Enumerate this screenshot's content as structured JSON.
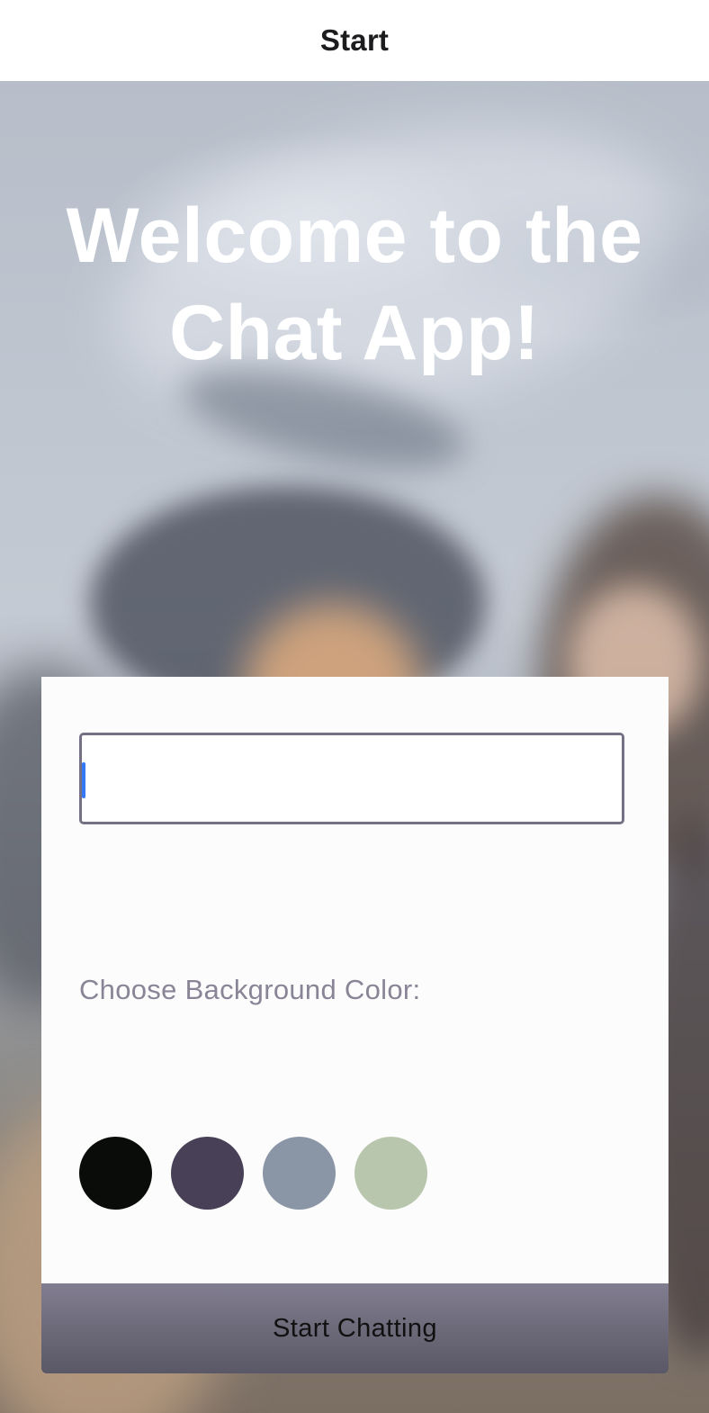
{
  "nav": {
    "title": "Start"
  },
  "welcome": {
    "line1": "Welcome to the",
    "line2": "Chat App!"
  },
  "form": {
    "name_input_value": "",
    "color_label": "Choose Background Color:",
    "colors": [
      {
        "name": "black",
        "hex": "#090C08"
      },
      {
        "name": "purple-gray",
        "hex": "#474056"
      },
      {
        "name": "slate",
        "hex": "#8A95A5"
      },
      {
        "name": "sage",
        "hex": "#B9C6AE"
      }
    ],
    "start_button_label": "Start Chatting"
  },
  "theme": {
    "input_border": "#757083",
    "button": "#757083",
    "caret": "#3478f6"
  }
}
